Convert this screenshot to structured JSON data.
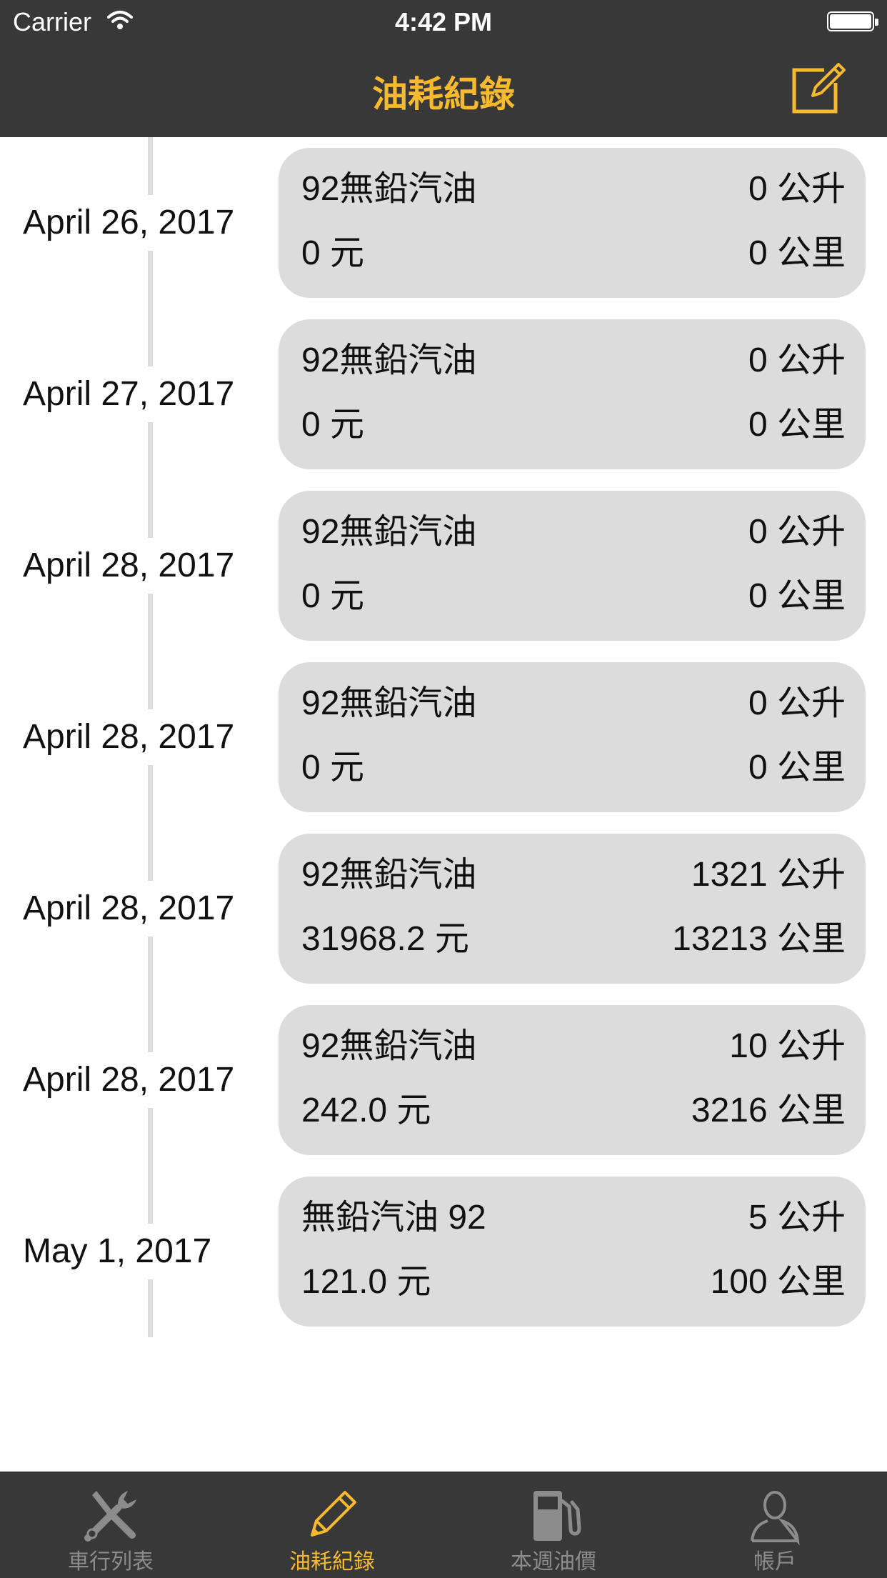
{
  "status_bar": {
    "carrier": "Carrier",
    "time": "4:42 PM"
  },
  "nav": {
    "title": "油耗紀錄"
  },
  "records": [
    {
      "date": "April 26, 2017",
      "fuel": "92無鉛汽油",
      "liters": "0 公升",
      "cost": "0 元",
      "distance": "0 公里"
    },
    {
      "date": "April 27, 2017",
      "fuel": "92無鉛汽油",
      "liters": "0 公升",
      "cost": "0 元",
      "distance": "0 公里"
    },
    {
      "date": "April 28, 2017",
      "fuel": "92無鉛汽油",
      "liters": "0 公升",
      "cost": "0 元",
      "distance": "0 公里"
    },
    {
      "date": "April 28, 2017",
      "fuel": "92無鉛汽油",
      "liters": "0 公升",
      "cost": "0 元",
      "distance": "0 公里"
    },
    {
      "date": "April 28, 2017",
      "fuel": "92無鉛汽油",
      "liters": "1321 公升",
      "cost": "31968.2 元",
      "distance": "13213 公里"
    },
    {
      "date": "April 28, 2017",
      "fuel": "92無鉛汽油",
      "liters": "10 公升",
      "cost": "242.0 元",
      "distance": "3216 公里"
    },
    {
      "date": "May 1, 2017",
      "fuel": "無鉛汽油 92",
      "liters": "5 公升",
      "cost": "121.0 元",
      "distance": "100 公里"
    }
  ],
  "tabs": [
    {
      "label": "車行列表",
      "icon": "tools-icon",
      "active": false
    },
    {
      "label": "油耗紀錄",
      "icon": "pencil-icon",
      "active": true
    },
    {
      "label": "本週油價",
      "icon": "gas-pump-icon",
      "active": false
    },
    {
      "label": "帳戶",
      "icon": "person-icon",
      "active": false
    }
  ],
  "colors": {
    "accent": "#f7b92e",
    "bar": "#383838",
    "card": "#dcdcdc",
    "inactive": "#8c8c8c"
  }
}
